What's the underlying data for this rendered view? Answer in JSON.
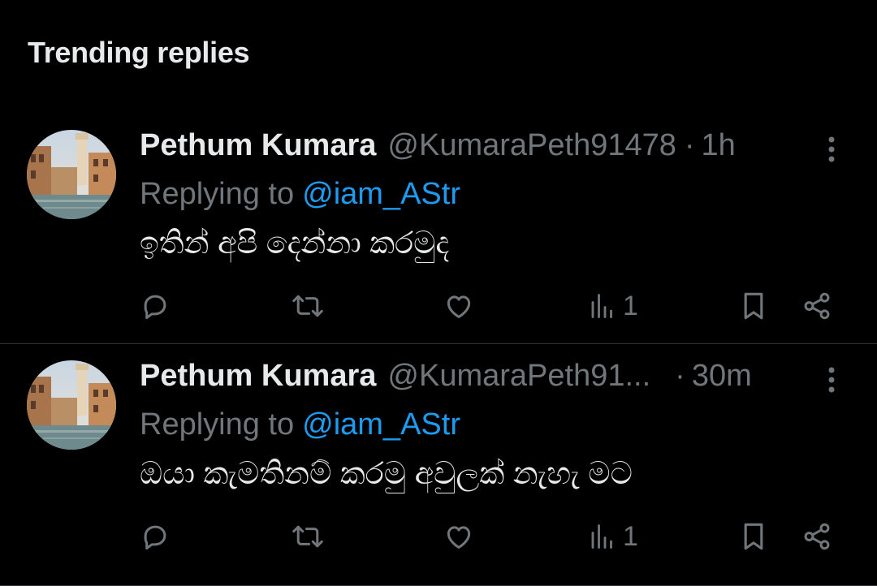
{
  "section": {
    "title": "Trending replies"
  },
  "colors": {
    "background": "#000000",
    "text": "#e7e9ea",
    "muted": "#71767b",
    "link": "#1d9bf0",
    "divider": "#2f3336"
  },
  "replies": [
    {
      "name": "Pethum Kumara",
      "handle": "@KumaraPeth91478",
      "separator": "·",
      "time": "1h",
      "replying_prefix": "Replying to",
      "replying_to": "@iam_AStr",
      "text": "ඉතින් අපි දෙන්නා කරමුද",
      "views": "1",
      "icons": {
        "more": "more-vertical-icon",
        "reply": "reply-icon",
        "repost": "repost-icon",
        "like": "heart-icon",
        "views": "views-icon",
        "bookmark": "bookmark-icon",
        "share": "share-icon"
      }
    },
    {
      "name": "Pethum Kumara",
      "handle": "@KumaraPeth91...",
      "separator": "·",
      "time": "30m",
      "replying_prefix": "Replying to",
      "replying_to": "@iam_AStr",
      "text": "ඔයා කැමතිනම් කරමු අවුලක් නැහැ මට",
      "views": "1",
      "icons": {
        "more": "more-vertical-icon",
        "reply": "reply-icon",
        "repost": "repost-icon",
        "like": "heart-icon",
        "views": "views-icon",
        "bookmark": "bookmark-icon",
        "share": "share-icon"
      }
    }
  ]
}
